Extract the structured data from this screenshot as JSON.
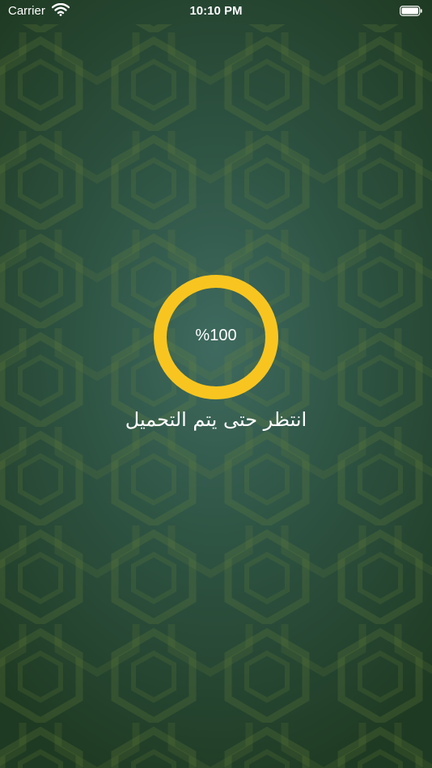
{
  "status_bar": {
    "carrier": "Carrier",
    "time": "10:10 PM",
    "wifi_icon": "wifi-icon",
    "battery_icon": "battery-icon"
  },
  "loader": {
    "progress_percent": 100,
    "progress_label": "%100",
    "ring_color": "#F8C520",
    "message": "انتظر حتى يتم التحميل"
  },
  "colors": {
    "background_center": "#3f6a5f",
    "background_edge": "#1f3a22",
    "pattern": "#5b7d3a"
  }
}
